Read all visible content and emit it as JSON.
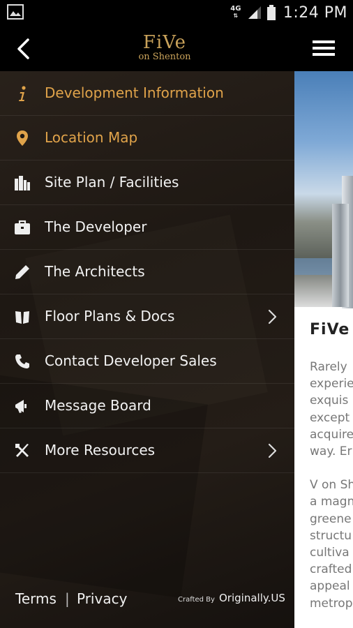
{
  "status_bar": {
    "network": "4G",
    "time": "1:24 PM"
  },
  "header": {
    "logo_main": "FiVe",
    "logo_sub": "on Shenton"
  },
  "menu": {
    "items": [
      {
        "label": "Development Information",
        "icon": "info-icon",
        "has_submenu": false,
        "accent": true
      },
      {
        "label": "Location Map",
        "icon": "location-pin-icon",
        "has_submenu": false,
        "accent": true
      },
      {
        "label": "Site Plan / Facilities",
        "icon": "buildings-icon",
        "has_submenu": false,
        "accent": false
      },
      {
        "label": "The Developer",
        "icon": "briefcase-icon",
        "has_submenu": false,
        "accent": false
      },
      {
        "label": "The Architects",
        "icon": "pencil-icon",
        "has_submenu": false,
        "accent": false
      },
      {
        "label": "Floor Plans & Docs",
        "icon": "book-icon",
        "has_submenu": true,
        "accent": false
      },
      {
        "label": "Contact Developer Sales",
        "icon": "phone-icon",
        "has_submenu": false,
        "accent": false
      },
      {
        "label": "Message Board",
        "icon": "megaphone-icon",
        "has_submenu": false,
        "accent": false
      },
      {
        "label": "More Resources",
        "icon": "tools-icon",
        "has_submenu": true,
        "accent": false
      }
    ]
  },
  "footer": {
    "terms": "Terms",
    "separator": "|",
    "privacy": "Privacy",
    "crafted_by": "Crafted By",
    "brand": "Originally.US"
  },
  "content": {
    "heading": "FiVe",
    "paragraph1": [
      "Rarely",
      "experie",
      "exquis",
      "except",
      "acquire",
      "way. Er"
    ],
    "paragraph2": [
      "V on Sh",
      "a magn",
      "greene",
      "structu",
      "cultiva",
      "crafted",
      "appeal",
      "metrop"
    ]
  },
  "colors": {
    "accent": "#e0a34a",
    "logo": "#c9a25a",
    "drawer_bg": "#1e1813"
  }
}
